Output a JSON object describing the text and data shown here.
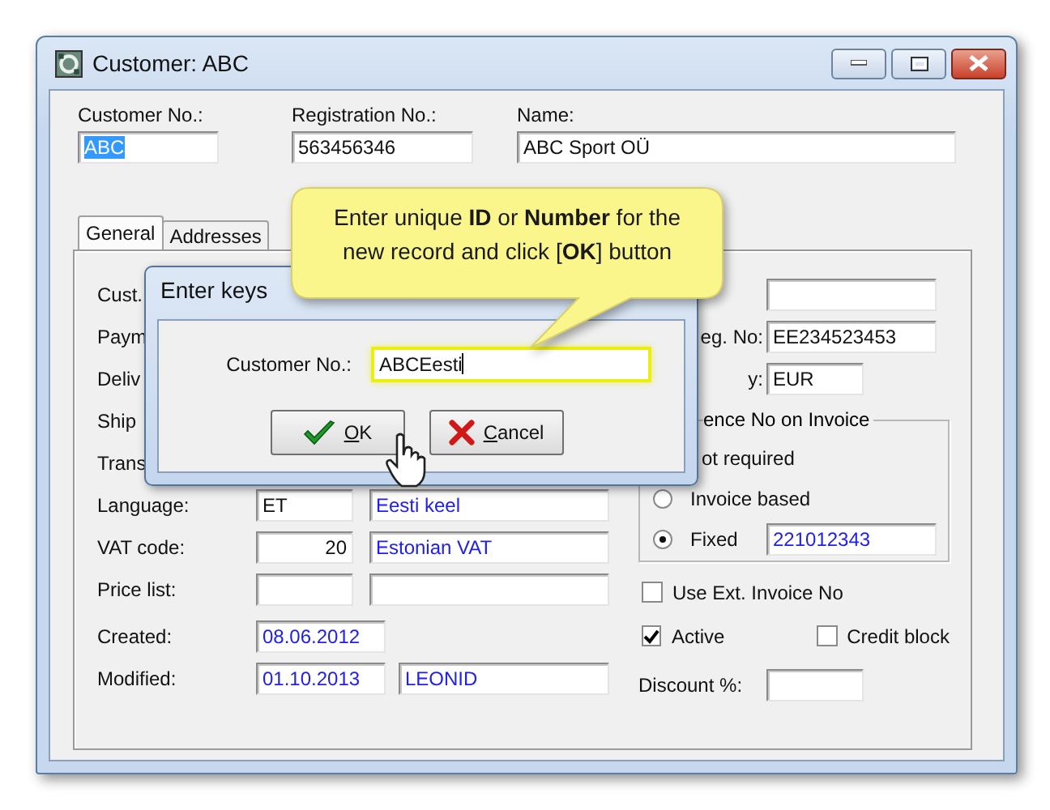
{
  "window": {
    "title": "Customer: ABC"
  },
  "header_fields": [
    {
      "label": "Customer No.:",
      "value": "ABC",
      "selected": true
    },
    {
      "label": "Registration No.:",
      "value": "563456346",
      "selected": false
    },
    {
      "label": "Name:",
      "value": "ABC Sport OÜ",
      "selected": false
    }
  ],
  "tabs": [
    {
      "label": "General",
      "selected": true
    },
    {
      "label": "Addresses",
      "selected": false
    }
  ],
  "left_rows": [
    {
      "kind": "label_only",
      "label": "Cust."
    },
    {
      "kind": "label_only",
      "label": "Paym"
    },
    {
      "kind": "label_only",
      "label": "Deliv"
    },
    {
      "kind": "label_only",
      "label": "Ship"
    },
    {
      "kind": "label_only",
      "label": "Trans"
    },
    {
      "kind": "pair",
      "label": "Language:",
      "code": "ET",
      "description": "Eesti keel",
      "numeric": false
    },
    {
      "kind": "pair",
      "label": "VAT code:",
      "code": "20",
      "description": "Estonian VAT",
      "numeric": true
    },
    {
      "kind": "pair",
      "label": "Price list:"
    },
    {
      "kind": "date",
      "label": "Created:",
      "date": "08.06.2012"
    },
    {
      "kind": "date",
      "label": "Modified:",
      "date": "01.10.2013",
      "user": "LEONID"
    }
  ],
  "right_rows": [
    {
      "kind": "field"
    },
    {
      "kind": "field",
      "label": "eg. No:",
      "value": "EE234523453"
    },
    {
      "kind": "short_field",
      "label": "y:",
      "value": "EUR"
    }
  ],
  "invoice_group": {
    "title": "ence No on Invoice",
    "options": [
      {
        "label": "ot required"
      },
      {
        "label": "Invoice based",
        "selected": false
      },
      {
        "label": "Fixed",
        "selected": true,
        "value": "221012343"
      }
    ]
  },
  "checkboxes": [
    {
      "label": "Use Ext. Invoice No",
      "checked": false
    },
    {
      "label": "Active",
      "checked": true
    },
    {
      "label": "Credit block",
      "checked": false
    }
  ],
  "discount": {
    "label": "Discount %:"
  },
  "dialog": {
    "title": "Enter keys",
    "field_label": "Customer No.:",
    "field_value": "ABCEesti",
    "buttons": [
      {
        "label": "OK",
        "kind": "ok"
      },
      {
        "label": "Cancel",
        "kind": "cancel"
      }
    ]
  },
  "callout": {
    "text": "Enter unique **ID** or **Number** for the new record and click [**OK**] button"
  }
}
